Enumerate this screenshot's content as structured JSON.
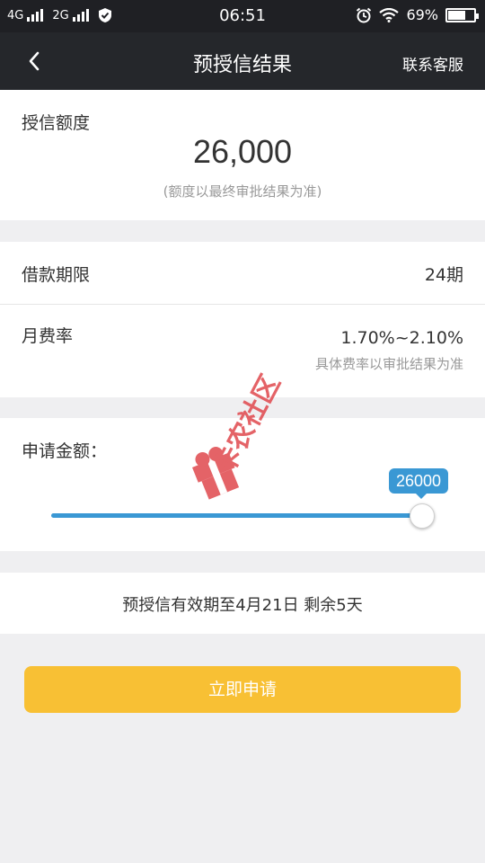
{
  "status_bar": {
    "network1": "4G",
    "network2": "2G",
    "time": "06:51",
    "battery_percent": "69%",
    "battery_level": 0.69
  },
  "header": {
    "title": "预授信结果",
    "contact_service": "联系客服"
  },
  "credit": {
    "label": "授信额度",
    "amount": "26,000",
    "note": "(额度以最终审批结果为准)"
  },
  "terms": {
    "period_label": "借款期限",
    "period_value": "24期",
    "rate_label": "月费率",
    "rate_value": "1.70%~2.10%",
    "rate_note": "具体费率以审批结果为准"
  },
  "application": {
    "amount_label": "申请金额：",
    "slider_value": "26000",
    "slider_fraction": 1.0
  },
  "validity_text": "预授信有效期至4月21日 剩余5天",
  "apply_button": "立即申请",
  "watermark_text": "卡农社区",
  "colors": {
    "header_bg": "#25272b",
    "slider_blue": "#3a98d4",
    "button_yellow": "#f8c034",
    "watermark_red": "#e0484d"
  }
}
